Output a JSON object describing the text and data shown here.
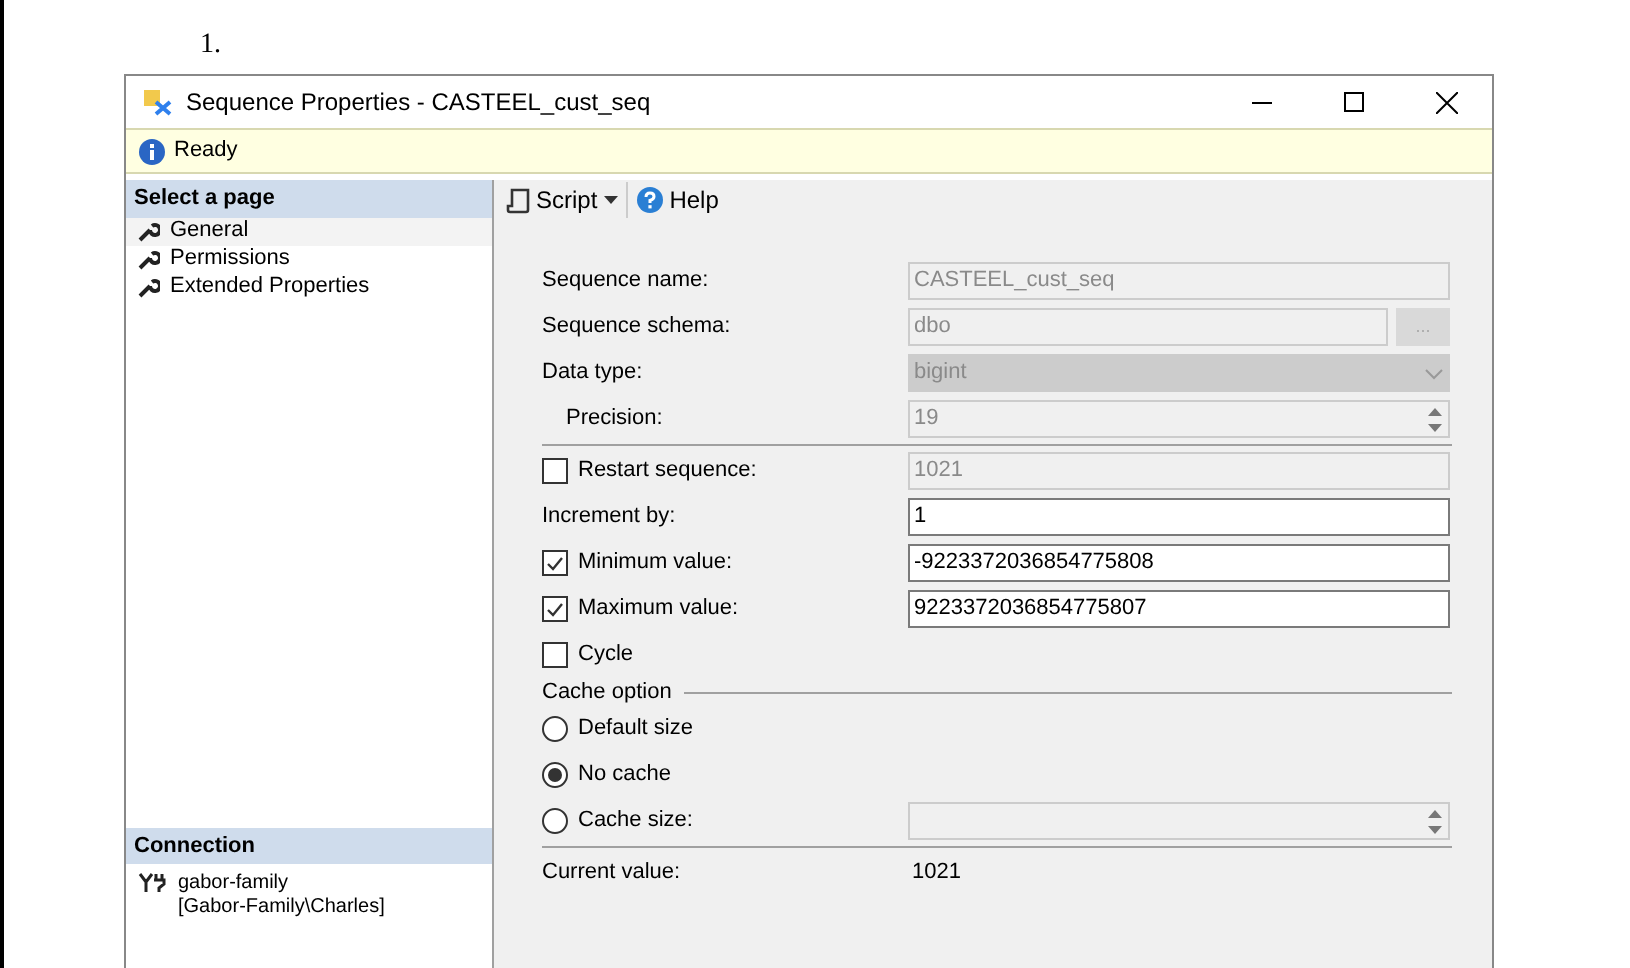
{
  "page_marker": "1.",
  "window": {
    "title": "Sequence Properties - CASTEEL_cust_seq"
  },
  "status": "Ready",
  "sidebar": {
    "heading": "Select a page",
    "items": [
      {
        "label": "General",
        "selected": true
      },
      {
        "label": "Permissions",
        "selected": false
      },
      {
        "label": "Extended Properties",
        "selected": false
      }
    ],
    "connection_heading": "Connection",
    "connection": [
      "gabor-family",
      "[Gabor-Family\\Charles]"
    ]
  },
  "toolbar": [
    {
      "kind": "dropdown",
      "label": "Script"
    },
    {
      "kind": "help",
      "label": "Help"
    }
  ],
  "form": {
    "sections": [
      {
        "rows": [
          {
            "kind": "field",
            "label": "Sequence name:",
            "value": "CASTEEL_cust_seq",
            "disabled": true
          },
          {
            "kind": "field",
            "label": "Sequence schema:",
            "value": "dbo",
            "disabled": true,
            "browse": "..."
          },
          {
            "kind": "combo",
            "label": "Data type:",
            "value": "bigint",
            "disabled": true,
            "children": [
              {
                "kind": "spin",
                "label": "Precision:",
                "value": "19",
                "disabled": true
              }
            ]
          }
        ]
      },
      {
        "rows": [
          {
            "kind": "check",
            "label": "Restart sequence:",
            "checked": false,
            "value": "1021",
            "disabled": true
          },
          {
            "kind": "field",
            "label": "Increment by:",
            "value": "1",
            "disabled": false
          },
          {
            "kind": "check",
            "label": "Minimum value:",
            "checked": true,
            "value": "-9223372036854775808",
            "disabled": false
          },
          {
            "kind": "check",
            "label": "Maximum value:",
            "checked": true,
            "value": "9223372036854775807",
            "disabled": false
          },
          {
            "kind": "check",
            "label": "Cycle",
            "checked": false
          }
        ]
      },
      {
        "heading": "Cache option",
        "rows": [
          {
            "kind": "radio",
            "label": "Default size",
            "selected": false
          },
          {
            "kind": "radio",
            "label": "No cache",
            "selected": true
          },
          {
            "kind": "radio_spin",
            "label": "Cache size:",
            "selected": false,
            "disabled": true
          }
        ]
      },
      {
        "rows": [
          {
            "kind": "readout",
            "label": "Current value:",
            "value": "1021"
          }
        ]
      }
    ]
  }
}
